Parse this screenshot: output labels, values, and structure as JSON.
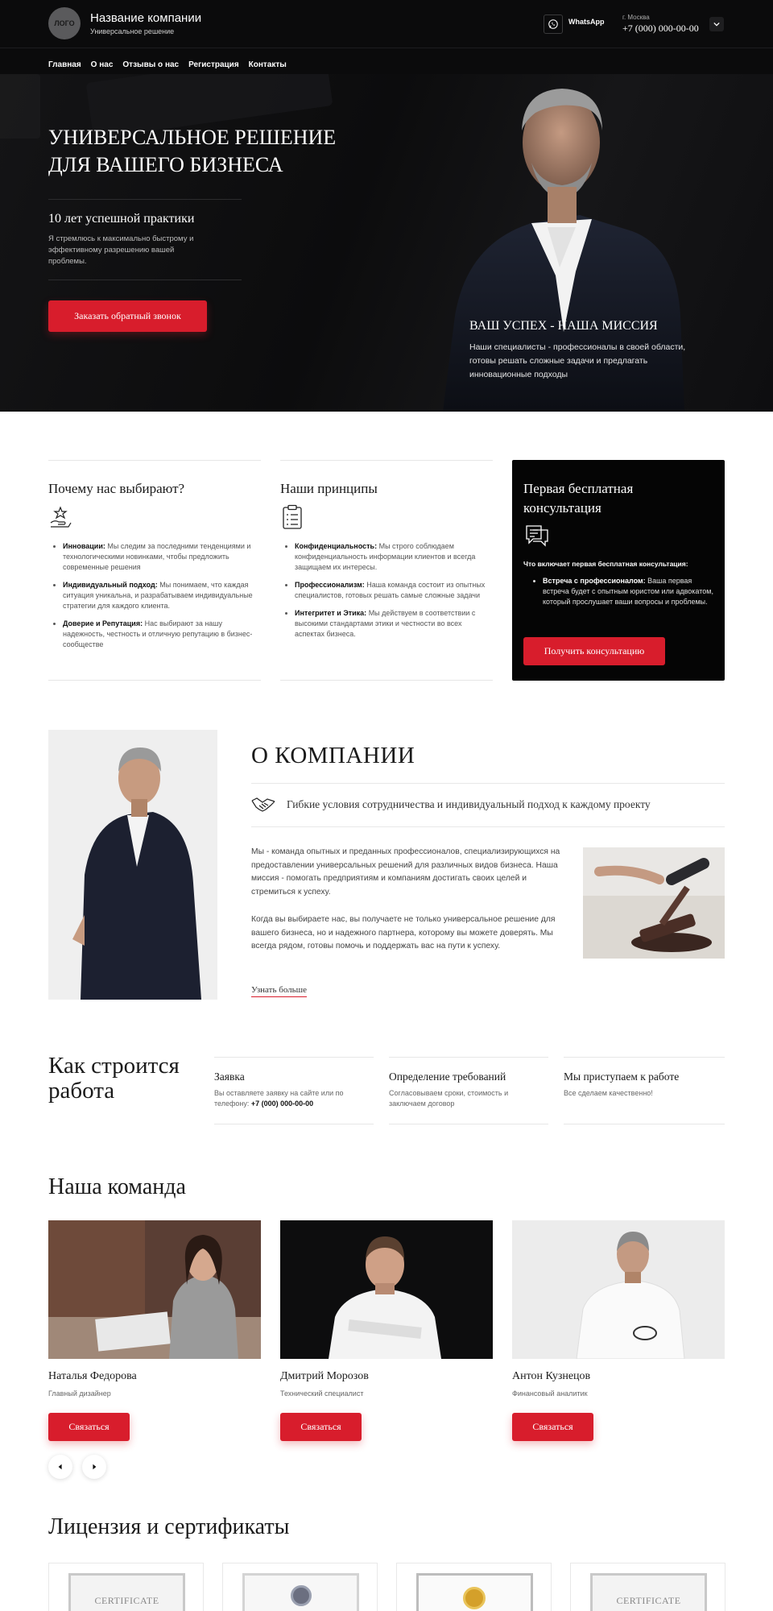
{
  "header": {
    "logo": "ЛОГО",
    "company_name": "Название компании",
    "company_tagline": "Универсальное решение",
    "whatsapp": "WhatsApp",
    "city": "г. Москва",
    "phone": "+7 (000) 000-00-00"
  },
  "nav": [
    "Главная",
    "О нас",
    "Отзывы о нас",
    "Регистрация",
    "Контакты"
  ],
  "hero": {
    "title_line1": "УНИВЕРСАЛЬНОЕ РЕШЕНИЕ",
    "title_line2": "ДЛЯ ВАШЕГО БИЗНЕСА",
    "subtitle": "10 лет успешной практики",
    "text": "Я стремлюсь к максимально быстрому и эффективному разрешению вашей проблемы.",
    "cta": "Заказать обратный звонок",
    "mission_title": "ВАШ УСПЕХ - НАША МИССИЯ",
    "mission_text": "Наши специалисты - профессионалы в своей области, готовы решать сложные задачи и предлагать инновационные подходы"
  },
  "why": {
    "title": "Почему нас выбирают?",
    "items": [
      {
        "bold": "Инновации:",
        "text": " Мы следим за последними тенденциями и технологическими новинками, чтобы предложить современные решения"
      },
      {
        "bold": "Индивидуальный подход:",
        "text": " Мы понимаем, что каждая ситуация уникальна, и разрабатываем индивидуальные стратегии для каждого клиента."
      },
      {
        "bold": "Доверие и Репутация:",
        "text": " Нас выбирают за нашу надежность, честность и отличную репутацию в бизнес-сообществе"
      }
    ]
  },
  "principles": {
    "title": "Наши принципы",
    "items": [
      {
        "bold": "Конфиденциальность:",
        "text": " Мы строго соблюдаем конфиденциальность информации клиентов и всегда защищаем их интересы."
      },
      {
        "bold": "Профессионализм:",
        "text": " Наша команда состоит из опытных специалистов, готовых решать самые сложные задачи"
      },
      {
        "bold": "Интегритет и Этика:",
        "text": " Мы действуем в соответствии с высокими стандартами этики и честности во всех аспектах бизнеса."
      }
    ]
  },
  "consult": {
    "title": "Первая бесплатная консультация",
    "includes": "Что включает первая бесплатная консультация:",
    "item_bold": "Встреча с профессионалом:",
    "item_text": " Ваша первая встреча будет с опытным юристом или адвокатом, который прослушает ваши вопросы и проблемы.",
    "button": "Получить консультацию"
  },
  "about": {
    "title": "О КОМПАНИИ",
    "feature": "Гибкие условия сотрудничества и индивидуальный подход к каждому проекту",
    "p1": "Мы - команда опытных и преданных профессионалов, специализирующихся на предоставлении универсальных решений для различных видов бизнеса. Наша миссия - помогать предприятиям и компаниям достигать своих целей и стремиться к успеху.",
    "p2": "Когда вы выбираете нас, вы получаете не только универсальное решение для вашего бизнеса, но и надежного партнера, которому вы можете доверять. Мы всегда рядом, готовы помочь и поддержать вас на пути к успеху.",
    "more": "Узнать больше"
  },
  "process": {
    "title_line1": "Как строится",
    "title_line2": "работа",
    "steps": [
      {
        "title": "Заявка",
        "text": "Вы оставляете заявку на сайте или по телефону: ",
        "phone": "+7 (000) 000-00-00"
      },
      {
        "title": "Определение требований",
        "text": "Согласовываем сроки, стоимость и заключаем договор",
        "phone": ""
      },
      {
        "title": "Мы приступаем к работе",
        "text": "Все сделаем качественно!",
        "phone": ""
      }
    ]
  },
  "team": {
    "title": "Наша команда",
    "members": [
      {
        "name": "Наталья Федорова",
        "role": "Главный дизайнер",
        "button": "Связаться"
      },
      {
        "name": "Дмитрий Морозов",
        "role": "Технический специалист",
        "button": "Связаться"
      },
      {
        "name": "Антон Кузнецов",
        "role": "Финансовый аналитик",
        "button": "Связаться"
      }
    ]
  },
  "certs": {
    "title": "Лицензия и сертификаты",
    "label": "CERTIFICATE"
  },
  "colors": {
    "accent": "#d81d2c",
    "dark": "#0b0b0c"
  }
}
